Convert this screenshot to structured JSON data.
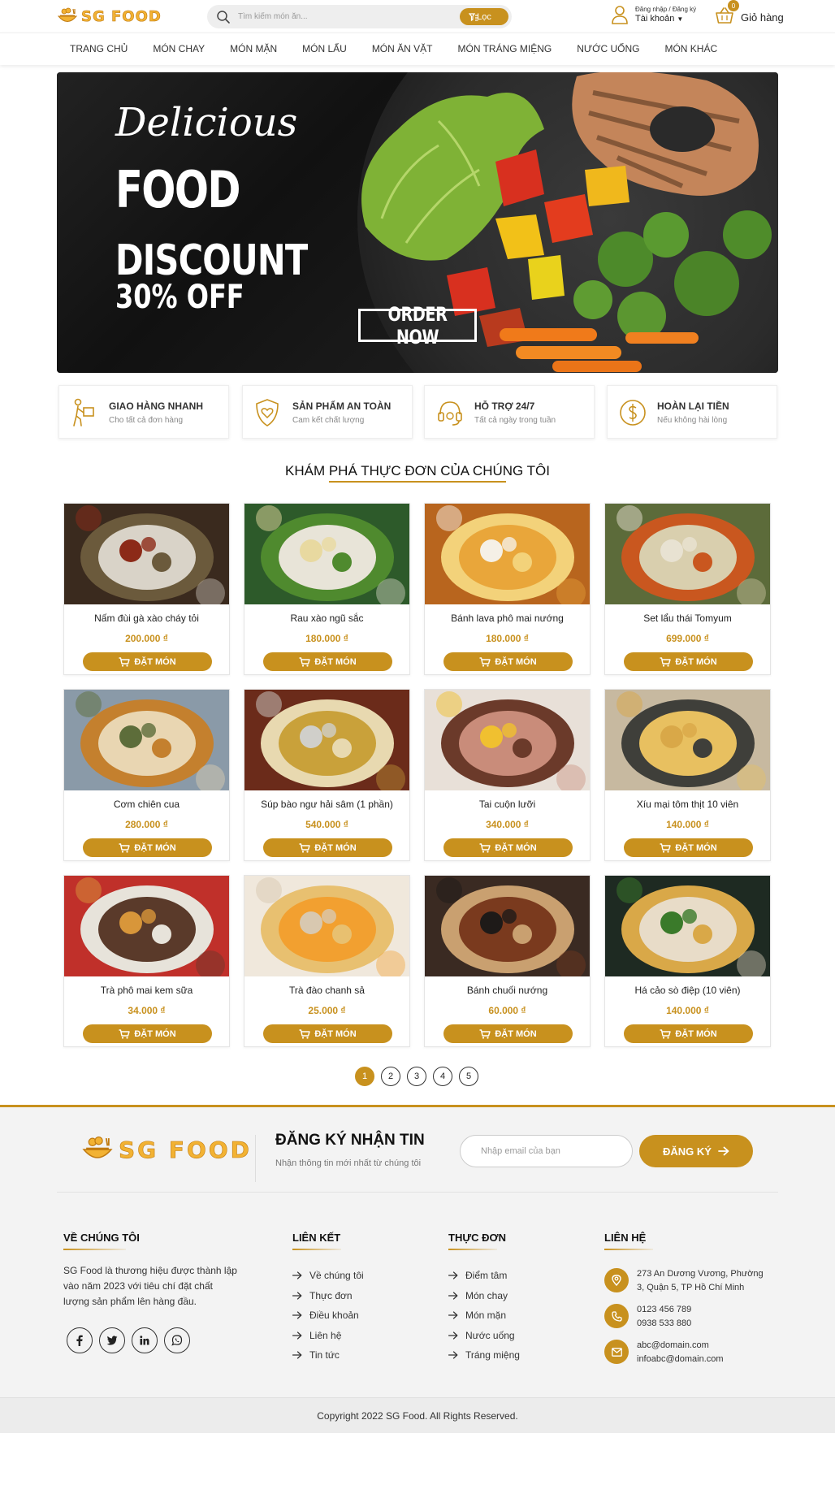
{
  "brand": {
    "name": "SG FOOD"
  },
  "search": {
    "placeholder": "Tìm kiếm món ăn...",
    "filter_label": "Lọc"
  },
  "account": {
    "top": "Đăng nhập / Đăng ký",
    "bottom": "Tài khoản"
  },
  "cart": {
    "count": "0",
    "label": "Giỏ hàng"
  },
  "nav": [
    {
      "label": "TRANG CHỦ"
    },
    {
      "label": "MÓN CHAY"
    },
    {
      "label": "MÓN MẶN"
    },
    {
      "label": "MÓN LẨU"
    },
    {
      "label": "MÓN ĂN VẶT"
    },
    {
      "label": "MÓN TRÁNG MIỆNG"
    },
    {
      "label": "NƯỚC UỐNG"
    },
    {
      "label": "MÓN KHÁC"
    }
  ],
  "banner": {
    "line1": "Delicious",
    "line2": "FOOD",
    "line3": "DISCOUNT",
    "line4": "30% OFF",
    "cta": "ORDER NOW"
  },
  "features": [
    {
      "icon": "delivery-person-icon",
      "title": "GIAO HÀNG NHANH",
      "subtitle": "Cho tất cả đơn hàng"
    },
    {
      "icon": "shield-heart-icon",
      "title": "SẢN PHẨM AN TOÀN",
      "subtitle": "Cam kết chất lượng"
    },
    {
      "icon": "headset-icon",
      "title": "HỖ TRỢ 24/7",
      "subtitle": "Tất cả ngày trong tuần"
    },
    {
      "icon": "dollar-coin-icon",
      "title": "HOÀN LẠI TIỀN",
      "subtitle": "Nếu không hài lòng"
    }
  ],
  "menu_title": "KHÁM PHÁ THỰC ĐƠN CỦA CHÚNG TÔI",
  "order_label": "ĐẶT MÓN",
  "products": [
    {
      "name": "Nấm đùi gà xào cháy tỏi",
      "price": "200.000 ₫",
      "palette": [
        "#3a2a1e",
        "#d9d3c8",
        "#6b5a3c",
        "#8c2a18"
      ]
    },
    {
      "name": "Rau xào ngũ sắc",
      "price": "180.000 ₫",
      "palette": [
        "#2d5a2a",
        "#e8e4d8",
        "#4f8a2e",
        "#e8d9a0"
      ]
    },
    {
      "name": "Bánh lava phô mai nướng",
      "price": "180.000 ₫",
      "palette": [
        "#b8651e",
        "#e9a63a",
        "#f3d27a",
        "#f5f0e6"
      ]
    },
    {
      "name": "Set lẩu thái Tomyum",
      "price": "699.000 ₫",
      "palette": [
        "#5c6b3a",
        "#d9cfae",
        "#c9571f",
        "#e8e2d2"
      ]
    },
    {
      "name": "Cơm chiên cua",
      "price": "280.000 ₫",
      "palette": [
        "#8a9aa8",
        "#e9d6b2",
        "#c4802e",
        "#5d6d3a"
      ]
    },
    {
      "name": "Súp bào ngư hải sâm (1 phần)",
      "price": "540.000 ₫",
      "palette": [
        "#6b2b1a",
        "#c9a13a",
        "#e8d9b0",
        "#d0cfca"
      ]
    },
    {
      "name": "Tai cuộn lưỡi",
      "price": "340.000 ₫",
      "palette": [
        "#e8e0d8",
        "#c98c7a",
        "#6b3a2a",
        "#f0c030"
      ]
    },
    {
      "name": "Xíu mại tôm thịt 10 viên",
      "price": "140.000 ₫",
      "palette": [
        "#c7b9a0",
        "#e8c060",
        "#3f3f3a",
        "#d9a848"
      ]
    },
    {
      "name": "Trà phô mai kem sữa",
      "price": "34.000 ₫",
      "palette": [
        "#c0302a",
        "#5a3a2a",
        "#e7e3da",
        "#d8963a"
      ]
    },
    {
      "name": "Trà đào chanh sả",
      "price": "25.000 ₫",
      "palette": [
        "#f0e8dc",
        "#f2a030",
        "#e8c070",
        "#d8c8b0"
      ]
    },
    {
      "name": "Bánh chuối nướng",
      "price": "60.000 ₫",
      "palette": [
        "#3a2a22",
        "#7a3a1e",
        "#c9a070",
        "#1e1a18"
      ]
    },
    {
      "name": "Há cảo sò điệp (10 viên)",
      "price": "140.000 ₫",
      "palette": [
        "#1e2a22",
        "#e8dcc8",
        "#d9a848",
        "#3a7a2a"
      ]
    }
  ],
  "pagination": [
    "1",
    "2",
    "3",
    "4",
    "5"
  ],
  "newsletter": {
    "title": "ĐĂNG KÝ NHẬN TIN",
    "subtitle": "Nhận thông tin mới nhất từ chúng tôi",
    "placeholder": "Nhập email của bạn",
    "button": "ĐĂNG KÝ"
  },
  "footer": {
    "about_title": "VỀ CHÚNG TÔI",
    "about_text": "SG Food là thương hiệu được thành lập vào năm 2023 với tiêu chí đặt chất lượng sản phẩm lên hàng đầu.",
    "socials": [
      "facebook-icon",
      "twitter-icon",
      "linkedin-icon",
      "whatsapp-icon"
    ],
    "links_title": "LIÊN KẾT",
    "links": [
      "Về chúng tôi",
      "Thực đơn",
      "Điều khoản",
      "Liên hệ",
      "Tin tức"
    ],
    "menu_title": "THỰC ĐƠN",
    "menu_links": [
      "Điểm tâm",
      "Món chay",
      "Món mặn",
      "Nước uống",
      "Tráng miệng"
    ],
    "contact_title": "LIÊN HỆ",
    "address": "273 An Dương Vương, Phường 3, Quận 5, TP Hồ Chí Minh",
    "phone1": "0123 456 789",
    "phone2": "0938 533 880",
    "email1": "abc@domain.com",
    "email2": "infoabc@domain.com"
  },
  "copyright": "Copyright 2022 SG Food. All Rights Reserved.",
  "colors": {
    "accent": "#c8911e",
    "logo": "#f2b233"
  }
}
